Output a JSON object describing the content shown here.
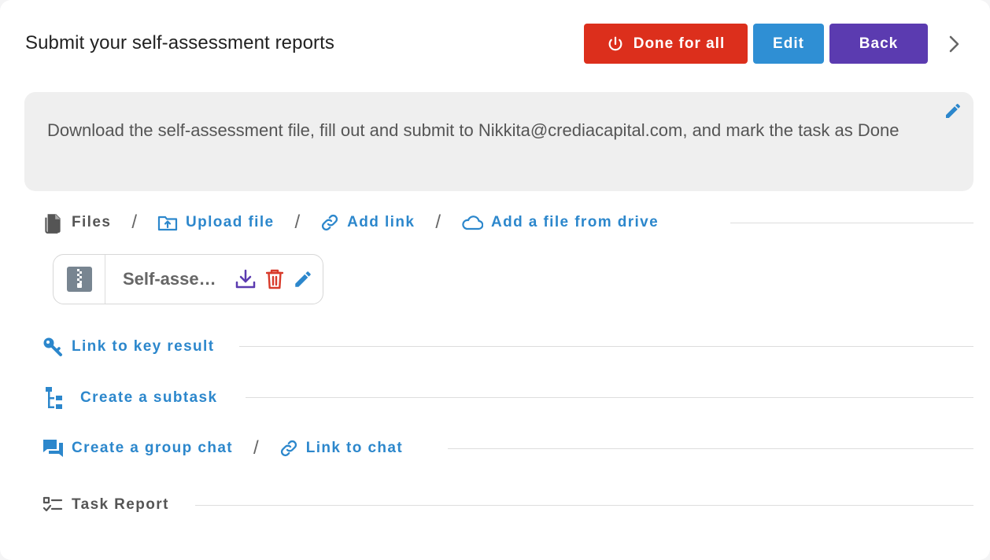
{
  "header": {
    "title": "Submit your self-assessment reports",
    "done_label": "Done for all",
    "edit_label": "Edit",
    "back_label": "Back"
  },
  "description": {
    "text": "Download the self-assessment file, fill out and submit to Nikkita@crediacapital.com, and mark the task as Done"
  },
  "files": {
    "label": "Files",
    "upload_label": "Upload file",
    "add_link_label": "Add link",
    "drive_label": "Add a file from drive",
    "items": [
      {
        "name": "Self-assessment"
      }
    ]
  },
  "actions": {
    "key_result_label": "Link to key result",
    "subtask_label": "Create a subtask",
    "group_chat_label": "Create a group chat",
    "link_chat_label": "Link to chat",
    "task_report_label": "Task Report"
  },
  "colors": {
    "done": "#dc2f1c",
    "edit": "#2f8fd4",
    "back": "#5b3bb0",
    "link": "#2c87cc",
    "delete": "#d83a2a",
    "download": "#5b3bb0"
  }
}
